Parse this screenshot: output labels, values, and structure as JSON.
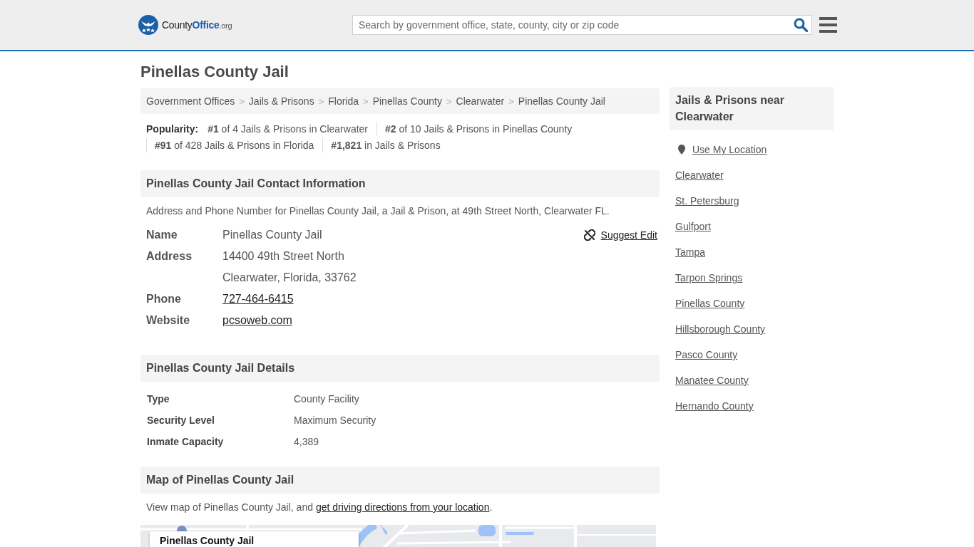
{
  "header": {
    "logo": {
      "text": "County",
      "highlight": "Office",
      "suffix": ".org"
    },
    "search": {
      "placeholder": "Search by government office, state, county, city or zip code"
    }
  },
  "page_title": "Pinellas County Jail",
  "breadcrumb": {
    "separator": ">",
    "items": [
      "Government Offices",
      "Jails & Prisons",
      "Florida",
      "Pinellas County",
      "Clearwater",
      "Pinellas County Jail"
    ]
  },
  "popularity": {
    "label": "Popularity:",
    "items": [
      "**#1** of 4 Jails & Prisons in Clearwater",
      "**#2** of 10 Jails & Prisons in Pinellas County",
      "**#91** of 428 Jails & Prisons in Florida",
      "**#1,821** in Jails & Prisons"
    ]
  },
  "contact": {
    "heading": "Pinellas County Jail Contact Information",
    "description": "Address and Phone Number for Pinellas County Jail, a Jail & Prison, at 49th Street North, Clearwater FL.",
    "suggest_edit": "Suggest Edit",
    "rows": [
      {
        "label": "Name",
        "values": [
          {
            "kind": "text",
            "text": "Pinellas County Jail"
          }
        ]
      },
      {
        "label": "Address",
        "values": [
          {
            "kind": "text",
            "text": "14400 49th Street North"
          },
          {
            "kind": "text",
            "text": "Clearwater, Florida, 33762"
          }
        ]
      },
      {
        "label": "Phone",
        "values": [
          {
            "kind": "link",
            "text": "727-464-6415"
          }
        ]
      },
      {
        "label": "Website",
        "values": [
          {
            "kind": "link",
            "text": "pcsoweb.com"
          }
        ]
      }
    ]
  },
  "details": {
    "heading": "Pinellas County Jail Details",
    "rows": [
      {
        "label": "Type",
        "value": "County Facility"
      },
      {
        "label": "Security Level",
        "value": "Maximum Security"
      },
      {
        "label": "Inmate Capacity",
        "value": "4,389"
      }
    ]
  },
  "map": {
    "heading": "Map of Pinellas County Jail",
    "description": {
      "text": "View map of Pinellas County Jail, and ",
      "link": "get driving directions from your location",
      "end": "."
    },
    "info_title": "Pinellas County Jail"
  },
  "sidebar": {
    "heading": "Jails & Prisons near Clearwater",
    "location_link": "Use My Location",
    "links": [
      "Clearwater",
      "St. Petersburg",
      "Gulfport",
      "Tampa",
      "Tarpon Springs",
      "Pinellas County",
      "Hillsborough County",
      "Pasco County",
      "Manatee County",
      "Hernando County"
    ]
  }
}
